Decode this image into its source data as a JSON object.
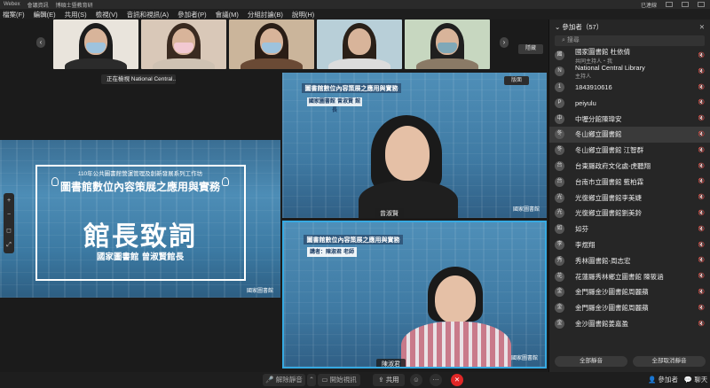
{
  "titlebar": {
    "app": "Webex",
    "meeting": "會議資訊",
    "title": "博碩士暨教育研",
    "status": "已連線"
  },
  "menu": [
    "檔案(F)",
    "編輯(E)",
    "共用(S)",
    "檢視(V)",
    "音訊和視訊(A)",
    "參加者(P)",
    "會議(M)",
    "分組討論(B)",
    "說明(H)"
  ],
  "thumbnails": {
    "viewing": "正在檢視 National Central...",
    "hide": "隱藏"
  },
  "share": {
    "workshop": "110年公共圖書館營運管理及創新發展系列工作坊",
    "topic": "圖書館數位內容策展之應用與實務",
    "title": "館長致詞",
    "speaker": "國家圖書館 曾淑賢館長",
    "logo": "國家圖書館"
  },
  "tiles": {
    "top": {
      "banner": "圖書館數位內容策展之應用與實務",
      "sub": "國家圖書館 曾淑賢 館長",
      "name": "曾淑賢",
      "logo": "國家圖書館"
    },
    "bottom": {
      "banner": "圖書館數位內容策展之應用與實務",
      "sub": "講者：陳淑君 老師",
      "name": "陳淑君",
      "logo": "國家圖書館"
    },
    "layout_btn": "版面"
  },
  "panel": {
    "header": "參加者（57）",
    "search_placeholder": "搜尋",
    "participants": [
      {
        "name": "國家圖書館 杜依倩",
        "role": "共同主持人・我",
        "initial": "國"
      },
      {
        "name": "National Central Library",
        "role": "主持人",
        "initial": "N"
      },
      {
        "name": "1843910616",
        "role": "",
        "initial": "1"
      },
      {
        "name": "peiyulu",
        "role": "",
        "initial": "P"
      },
      {
        "name": "中壢分館陳瑋安",
        "role": "",
        "initial": "中"
      },
      {
        "name": "冬山鄉立圖書館",
        "role": "",
        "initial": "冬"
      },
      {
        "name": "冬山鄉立圖書館 江智群",
        "role": "",
        "initial": "冬"
      },
      {
        "name": "台東縣政府文化處-虎聽翔",
        "role": "",
        "initial": "台"
      },
      {
        "name": "台南市立圖書館 藍柏霖",
        "role": "",
        "initial": "台"
      },
      {
        "name": "光復鄉立圖書館李美婕",
        "role": "",
        "initial": "光"
      },
      {
        "name": "光復鄉立圖書館劉美鈴",
        "role": "",
        "initial": "光"
      },
      {
        "name": "如芬",
        "role": "",
        "initial": "如"
      },
      {
        "name": "李煜翔",
        "role": "",
        "initial": "李"
      },
      {
        "name": "秀林圖書館-周志宏",
        "role": "",
        "initial": "秀"
      },
      {
        "name": "花蓮縣秀林鄉立圖書館 陳筱涵",
        "role": "",
        "initial": "花"
      },
      {
        "name": "金門縣金沙圖書館周麗蘋",
        "role": "",
        "initial": "金"
      },
      {
        "name": "金門縣金沙圖書館周麗蘋",
        "role": "",
        "initial": "金"
      },
      {
        "name": "金沙圖書館姜嘉盈",
        "role": "",
        "initial": "金"
      }
    ],
    "mute_all": "全部靜音",
    "unmute_all": "全部取消靜音"
  },
  "toolbar": {
    "mute": "解除靜音",
    "video": "開始視訊",
    "share": "共用",
    "participants": "參加者",
    "chat": "聊天"
  }
}
